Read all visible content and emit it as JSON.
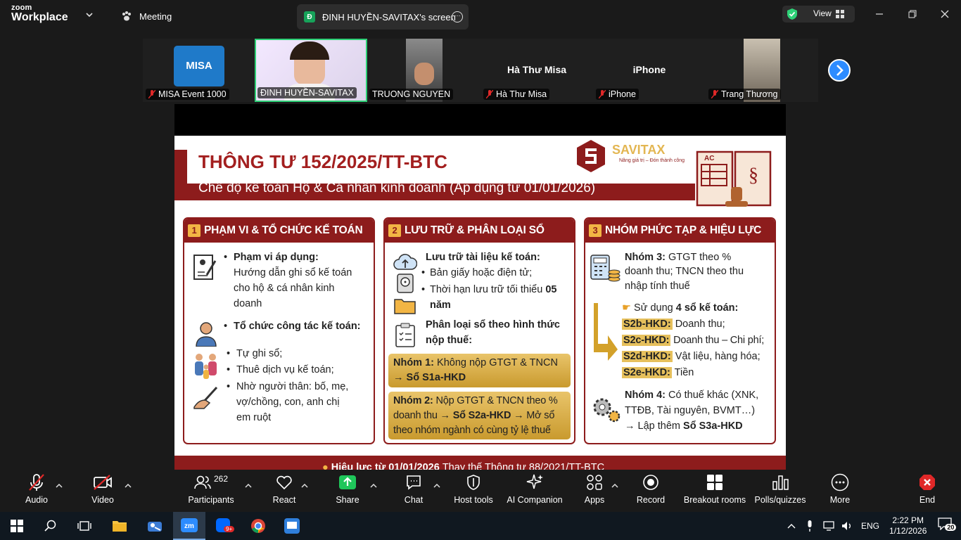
{
  "app": {
    "logo_line1": "zoom",
    "logo_line2": "Workplace"
  },
  "titlebar": {
    "meeting_label": "Meeting",
    "share_badge": "Đ",
    "share_title": "ĐINH HUYỀN-SAVITAX's screen",
    "share_more": "···",
    "view_label": "View",
    "colors": {
      "security_green": "#2ed177"
    }
  },
  "gallery": {
    "tiles": [
      {
        "name": "MISA Event 1000",
        "muted": true,
        "logo_text": "MISA"
      },
      {
        "name": "ĐINH HUYỀN-SAVITAX",
        "muted": false,
        "active": true
      },
      {
        "name": "TRUONG NGUYEN",
        "muted": false
      },
      {
        "name": "Hà Thư Misa",
        "muted": true,
        "big_name": "Hà Thư Misa"
      },
      {
        "name": "iPhone",
        "muted": true,
        "big_name": "iPhone"
      },
      {
        "name": "Trang Thương",
        "muted": true
      }
    ]
  },
  "slide": {
    "title": "THÔNG TƯ 152/2025/TT-BTC",
    "subtitle": "Chế độ kế toán Hộ & Cá nhân kinh doanh (Áp dụng từ 01/01/2026)",
    "brand": "SAVITAX",
    "brand_tagline": "Nâng giá trị – Đón thành công",
    "book_label": "AC",
    "panels": [
      {
        "num": "1",
        "header": "PHẠM VI & TỔ CHỨC KẾ TOÁN",
        "scope_title": "Phạm vi áp dụng:",
        "scope_lines": [
          "Hướng dẫn ghi sổ kế toán",
          "cho hộ & cá nhân kinh",
          "doanh"
        ],
        "org_title": "Tổ chức công tác kế toán:",
        "org_items": [
          "Tự ghi sổ;",
          "Thuê dịch vụ kế toán;",
          "Nhờ người thân: bố, mẹ,",
          "vợ/chồng, con, anh chị",
          "em ruột"
        ]
      },
      {
        "num": "2",
        "header": "LƯU TRỮ & PHÂN LOẠI SỔ",
        "storage_title": "Lưu trữ tài liệu kế toán:",
        "storage_items": [
          "Bản giấy hoặc điện tử;",
          "Thời hạn lưu trữ tối thiểu",
          "05",
          "năm"
        ],
        "class_title_1": "Phân loại sổ theo hình thức",
        "class_title_2": "nộp thuế:",
        "group1_label": "Nhóm 1:",
        "group1_text": "Không nộp GTGT & TNCN",
        "group1_line2": "→ Sổ S1a-HKD",
        "group2_label": "Nhóm 2:",
        "group2_text": "Nộp GTGT & TNCN theo %",
        "group2_line2_a": "doanh thu →",
        "group2_line2_b": "Sổ S2a-HKD",
        "group2_line2_c": "→ Mở sổ",
        "group2_line3": "theo nhóm ngành có cùng tỷ lệ thuế"
      },
      {
        "num": "3",
        "header": "NHÓM PHỨC TẠP & HIỆU LỰC",
        "g3_label": "Nhóm 3:",
        "g3_text": "GTGT theo %",
        "g3_line2": "doanh thu; TNCN theo thu",
        "g3_line3": "nhập tính thuế",
        "use_prefix": "Sử dụng",
        "use_bold": "4 sổ kế toán:",
        "books": [
          {
            "code": "S2b-HKD:",
            "desc": "Doanh thu;"
          },
          {
            "code": "S2c-HKD:",
            "desc": "Doanh thu – Chi phí;"
          },
          {
            "code": "S2d-HKD:",
            "desc": "Vật liệu, hàng hóa;"
          },
          {
            "code": "S2e-HKD:",
            "desc": "Tiền"
          }
        ],
        "g4_label": "Nhóm 4:",
        "g4_text": "Có thuế khác (XNK,",
        "g4_line2": "TTĐB, Tài nguyên, BVMT…)",
        "g4_line3_a": "→ Lập thêm",
        "g4_line3_b": "Sổ S3a-HKD"
      }
    ],
    "footer_bold": "Hiệu lực từ 01/01/2026",
    "footer_rest": "Thay thế Thông tư 88/2021/TT-BTC"
  },
  "toolbar": {
    "audio": "Audio",
    "video": "Video",
    "participants": "Participants",
    "participants_count": "262",
    "react": "React",
    "share": "Share",
    "chat": "Chat",
    "host_tools": "Host tools",
    "ai_companion": "AI Companion",
    "apps": "Apps",
    "record": "Record",
    "breakout_rooms": "Breakout rooms",
    "polls": "Polls/quizzes",
    "more": "More",
    "end": "End",
    "colors": {
      "share_green": "#1fc65a",
      "end_red": "#e02828"
    }
  },
  "taskbar": {
    "lang": "ENG",
    "time": "2:22 PM",
    "date": "1/12/2026",
    "notif_count": "20",
    "badge_count": "9+"
  }
}
